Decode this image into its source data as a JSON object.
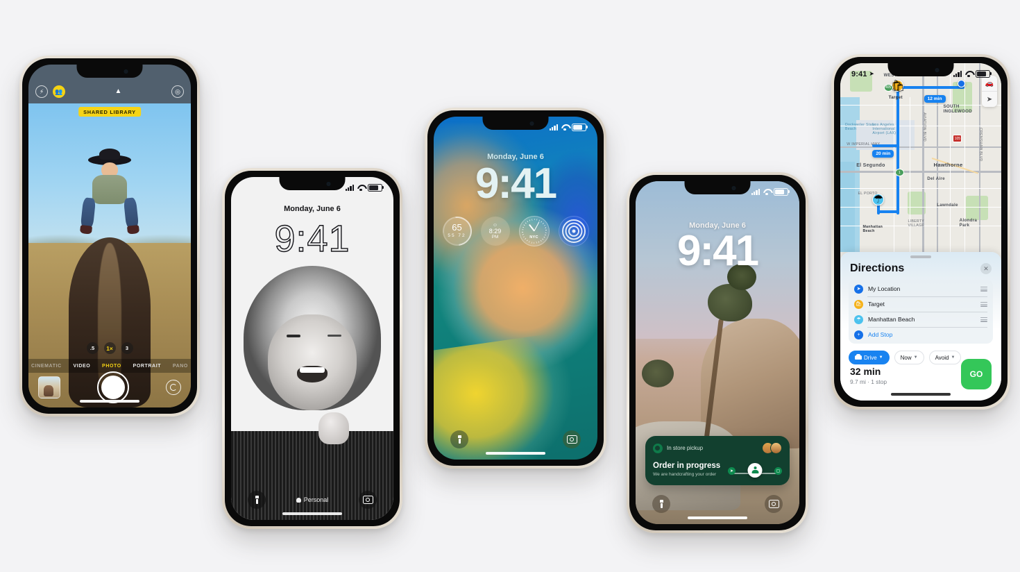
{
  "page": {
    "background_color": "#f3f3f5"
  },
  "phones": {
    "camera": {
      "status": {
        "flash_icon": "flash-icon",
        "shared_library_icon": "people-icon",
        "chevron_icon": "chevron-up-icon",
        "live_photo_icon": "live-photo-icon"
      },
      "shared_library_badge": "SHARED LIBRARY",
      "zoom_levels": [
        ".5",
        "1×",
        "3"
      ],
      "zoom_active": "1×",
      "modes": [
        "CINEMATIC",
        "VIDEO",
        "PHOTO",
        "PORTRAIT",
        "PANO"
      ],
      "mode_active": "PHOTO",
      "accent_color": "#f5d313"
    },
    "lock_portrait": {
      "date": "Monday, June 6",
      "time": "9:41",
      "focus_label": "Personal",
      "flashlight_icon": "flashlight-icon",
      "camera_icon": "camera-icon"
    },
    "lock_widgets": {
      "date": "Monday, June 6",
      "time": "9:41",
      "widgets": [
        {
          "name": "weather-widget",
          "temperature": "65",
          "low": "55",
          "high": "72"
        },
        {
          "name": "sunset-widget",
          "time": "8:29",
          "period": "PM",
          "glyph": "sunset-icon"
        },
        {
          "name": "world-clock-widget",
          "city": "NYC"
        },
        {
          "name": "fitness-rings-widget",
          "label": "activity-rings-icon"
        }
      ],
      "flashlight_icon": "flashlight-icon",
      "camera_icon": "camera-icon"
    },
    "lock_live_activity": {
      "date": "Monday, June 6",
      "time": "9:41",
      "card": {
        "brand_icon": "starbucks-logo-icon",
        "pickup_label": "In store pickup",
        "order_items": [
          "sandwich-item-icon",
          "cold-brew-item-icon"
        ],
        "headline": "Order in progress",
        "subline": "We are handcrafting your order",
        "progress_steps": [
          "order-placed-icon",
          "preparing-icon",
          "ready-icon"
        ],
        "active_step_index": 1,
        "background_color": "#12402f"
      },
      "flashlight_icon": "flashlight-icon",
      "camera_icon": "camera-icon"
    },
    "maps": {
      "status": {
        "time": "9:41",
        "location_icon": "location-arrow-icon"
      },
      "map": {
        "eta_badges": [
          "12 min",
          "20 min"
        ],
        "place_labels": [
          "WESTCHESTER",
          "Target",
          "SOUTH INGLEWOOD",
          "Dockweiler State Beach",
          "Los Angeles International Airport (LAX)",
          "W IMPERIAL HWY",
          "El Segundo",
          "Hawthorne",
          "Del Aire",
          "EL PORTO",
          "Lawndale",
          "LIBERTY VILLAGE",
          "Alondra Park",
          "Manhattan Beach",
          "AVIATION BLVD",
          "CRENSHAW BLVD"
        ],
        "route_shields": [
          "405",
          "105",
          "1"
        ],
        "controls": [
          "car-mode-icon",
          "recenter-icon"
        ],
        "route_color": "#1782f0"
      },
      "sheet": {
        "title": "Directions",
        "close_icon": "close-icon",
        "stops": [
          {
            "label": "My Location",
            "icon": "current-location-icon"
          },
          {
            "label": "Target",
            "icon": "shopping-bag-icon"
          },
          {
            "label": "Manhattan Beach",
            "icon": "beach-icon"
          },
          {
            "label": "Add Stop",
            "icon": "plus-icon"
          }
        ],
        "filters": [
          {
            "label": "Drive",
            "icon": "car-icon",
            "active": true
          },
          {
            "label": "Now",
            "icon": "chevron-down-icon",
            "active": false
          },
          {
            "label": "Avoid",
            "icon": "chevron-down-icon",
            "active": false
          }
        ],
        "eta": "32 min",
        "eta_detail": "9.7 mi · 1 stop",
        "go_label": "GO",
        "go_color": "#34c759"
      }
    }
  }
}
